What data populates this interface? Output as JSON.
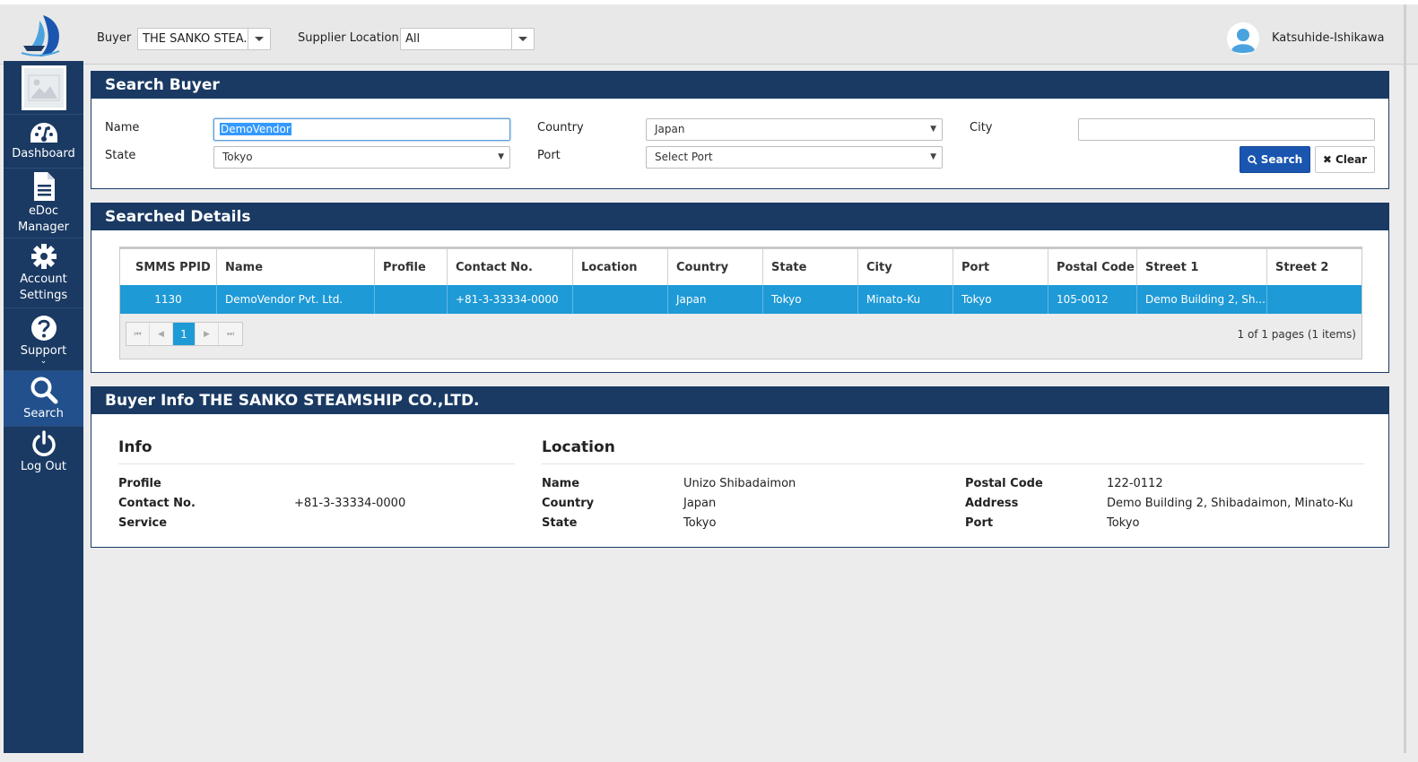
{
  "header": {
    "buyer_label": "Buyer",
    "buyer_value": "THE SANKO STEA...",
    "supplier_location_label": "Supplier Location",
    "supplier_location_value": "All",
    "username": "Katsuhide-Ishikawa"
  },
  "sidebar": {
    "items": [
      {
        "label": "Dashboard",
        "icon": "dashboard-icon"
      },
      {
        "label": "eDoc Manager",
        "icon": "document-icon"
      },
      {
        "label": "Account Settings",
        "icon": "gear-icon"
      },
      {
        "label": "Support",
        "icon": "question-icon"
      },
      {
        "label": "Search",
        "icon": "search-icon"
      },
      {
        "label": "Log Out",
        "icon": "power-icon"
      }
    ]
  },
  "search_panel": {
    "title": "Search Buyer",
    "name_label": "Name",
    "name_value": "DemoVendor",
    "country_label": "Country",
    "country_value": "Japan",
    "city_label": "City",
    "city_value": "",
    "state_label": "State",
    "state_value": "Tokyo",
    "port_label": "Port",
    "port_value": "Select Port",
    "search_button": "Search",
    "clear_button": "Clear"
  },
  "results_panel": {
    "title": "Searched Details",
    "columns": [
      "SMMS PPID",
      "Name",
      "Profile",
      "Contact No.",
      "Location",
      "Country",
      "State",
      "City",
      "Port",
      "Postal Code",
      "Street 1",
      "Street 2"
    ],
    "rows": [
      [
        "1130",
        "DemoVendor Pvt. Ltd.",
        "",
        "+81-3-33334-0000",
        "",
        "Japan",
        "Tokyo",
        "Minato-Ku",
        "Tokyo",
        "105-0012",
        "Demo Building 2, Sh...",
        ""
      ]
    ],
    "current_page": "1",
    "pager_info": "1 of 1 pages (1 items)"
  },
  "buyer_info": {
    "title": "Buyer Info THE SANKO STEAMSHIP CO.,LTD.",
    "info_heading": "Info",
    "location_heading": "Location",
    "profile_label": "Profile",
    "profile_value": "",
    "contact_label": "Contact No.",
    "contact_value": "+81-3-33334-0000",
    "service_label": "Service",
    "service_value": "",
    "loc_name_label": "Name",
    "loc_name_value": "Unizo Shibadaimon",
    "loc_country_label": "Country",
    "loc_country_value": "Japan",
    "loc_state_label": "State",
    "loc_state_value": "Tokyo",
    "postal_label": "Postal Code",
    "postal_value": "122-0112",
    "address_label": "Address",
    "address_value": "Demo Building 2, Shibadaimon, Minato-Ku",
    "port_label": "Port",
    "port_value": "Tokyo"
  },
  "colors": {
    "navy": "#1a3a63",
    "row_highlight": "#1e9ad6",
    "search_button": "#1a56b0"
  }
}
